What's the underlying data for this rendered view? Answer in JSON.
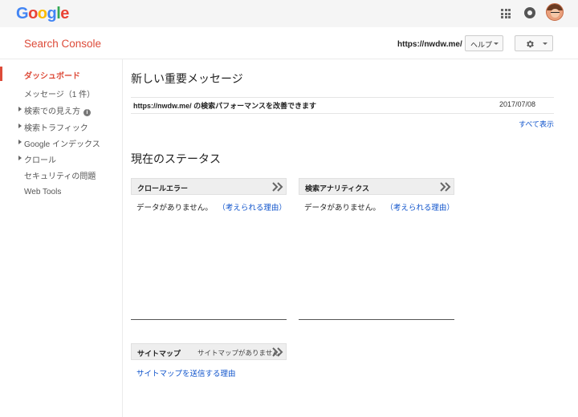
{
  "google_bar": {
    "logo_letters": [
      {
        "char": "G",
        "color": "#4285f4"
      },
      {
        "char": "o",
        "color": "#ea4335"
      },
      {
        "char": "o",
        "color": "#fbbc05"
      },
      {
        "char": "g",
        "color": "#4285f4"
      },
      {
        "char": "l",
        "color": "#34a853"
      },
      {
        "char": "e",
        "color": "#ea4335"
      }
    ],
    "icons": [
      "apps-grid-icon",
      "notifications-icon",
      "account-avatar"
    ]
  },
  "header": {
    "app_title": "Search Console",
    "site_url": "https://nwdw.me/",
    "help_label": "ヘルプ",
    "settings_icon": "gear-icon"
  },
  "sidebar": {
    "items": [
      {
        "label": "ダッシュボード",
        "active": true,
        "expandable": false
      },
      {
        "label": "メッセージ（1 件）",
        "active": false,
        "expandable": false
      },
      {
        "label": "検索での見え方",
        "active": false,
        "expandable": true,
        "info": "i"
      },
      {
        "label": "検索トラフィック",
        "active": false,
        "expandable": true
      },
      {
        "label": "Google インデックス",
        "active": false,
        "expandable": true
      },
      {
        "label": "クロール",
        "active": false,
        "expandable": true
      },
      {
        "label": "セキュリティの問題",
        "active": false,
        "expandable": false
      },
      {
        "label": "Web Tools",
        "active": false,
        "expandable": false
      }
    ]
  },
  "messages": {
    "title": "新しい重要メッセージ",
    "items": [
      {
        "text": "https://nwdw.me/ の検索パフォーマンスを改善できます",
        "date": "2017/07/08"
      }
    ],
    "show_all": "すべて表示"
  },
  "status": {
    "title": "現在のステータス",
    "crawl_errors": {
      "title": "クロールエラー",
      "body": "データがありません。",
      "link": "（考えられる理由）"
    },
    "search_analytics": {
      "title": "検索アナリティクス",
      "body": "データがありません。",
      "link": "（考えられる理由）"
    },
    "sitemaps": {
      "title": "サイトマップ",
      "subtitle": "サイトマップがありません",
      "link": "サイトマップを送信する理由"
    }
  },
  "colors": {
    "accent": "#dd4b39",
    "link": "#1155cc"
  }
}
